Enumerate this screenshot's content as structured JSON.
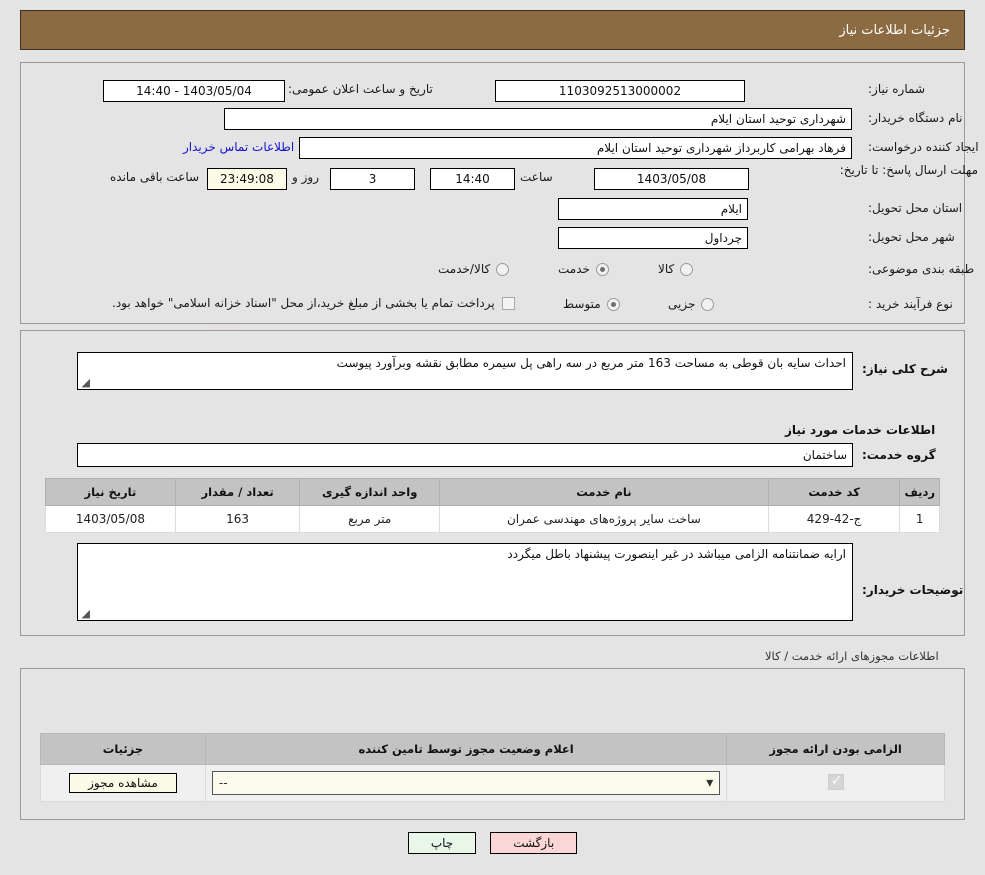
{
  "header": {
    "title": "جزئیات اطلاعات نیاز"
  },
  "form": {
    "need_number_label": "شماره نیاز:",
    "need_number": "1103092513000002",
    "announce_label": "تاریخ و ساعت اعلان عمومی:",
    "announce_value": "1403/05/04 - 14:40",
    "buyer_org_label": "نام دستگاه خریدار:",
    "buyer_org": "شهرداری توحید استان ایلام",
    "creator_label": "ایجاد کننده درخواست:",
    "creator": "فرهاد بهرامی کاربرداز شهرداری توحید استان ایلام",
    "contact_link": "اطلاعات تماس خریدار",
    "deadline_label": "مهلت ارسال پاسخ: تا تاریخ:",
    "deadline_date": "1403/05/08",
    "hour_label": "ساعت",
    "deadline_time": "14:40",
    "days_value": "3",
    "days_unit": "روز و",
    "countdown": "23:49:08",
    "countdown_suffix": "ساعت باقی مانده",
    "province_label": "استان محل تحویل:",
    "province": "ایلام",
    "city_label": "شهر محل تحویل:",
    "city": "چرداول",
    "category_label": "طبقه بندی موضوعی:",
    "category_options": [
      {
        "label": "کالا",
        "selected": false
      },
      {
        "label": "خدمت",
        "selected": true
      },
      {
        "label": "کالا/خدمت",
        "selected": false
      }
    ],
    "process_label": "نوع فرآیند خرید :",
    "process_options": [
      {
        "label": "جزیی",
        "selected": false
      },
      {
        "label": "متوسط",
        "selected": true
      }
    ],
    "treasury_checkbox_label": "پرداخت تمام یا بخشی از مبلغ خرید،از محل \"اسناد خزانه اسلامی\" خواهد بود.",
    "treasury_checked": false
  },
  "description": {
    "label": "شرح کلی نیاز:",
    "text": "احداث سایه بان قوطی به مساحت 163 متر مربع در سه راهی پل سیمره مطابق نقشه وبرآورد پیوست"
  },
  "services": {
    "section_title": "اطلاعات خدمات مورد نیاز",
    "group_label": "گروه خدمت:",
    "group_value": "ساختمان",
    "columns": [
      "ردیف",
      "کد خدمت",
      "نام خدمت",
      "واحد اندازه گیری",
      "تعداد / مقدار",
      "تاریخ نیاز"
    ],
    "rows": [
      {
        "index": "1",
        "code": "ج-42-429",
        "name": "ساخت سایر پروژه‌های مهندسی عمران",
        "unit": "متر مربع",
        "quantity": "163",
        "need_date": "1403/05/08"
      }
    ]
  },
  "buyer_notes": {
    "label": "توضیحات خریدار:",
    "text": "ارایه ضمانتنامه الزامی میباشد در غیر اینصورت پیشنهاد باطل میگردد"
  },
  "licenses": {
    "section_note": "اطلاعات مجوزهای ارائه خدمت / کالا",
    "columns": [
      "الزامی بودن ارائه مجوز",
      "اعلام وضعیت مجوز توسط تامین کننده",
      "جزئیات"
    ],
    "rows": [
      {
        "required_checked": true,
        "status_value": "--",
        "details_button": "مشاهده مجوز"
      }
    ]
  },
  "footer": {
    "print_label": "چاپ",
    "back_label": "بازگشت"
  },
  "watermark": {
    "text_main": "AriaTende",
    "text_tld": "r.net"
  },
  "colors": {
    "header_bg": "#8c6b43",
    "page_bg": "#e4e4e4",
    "link": "#1414d2",
    "table_header": "#c3c3c3",
    "print_btn": "#e9f7e9",
    "back_btn": "#fbd6d6",
    "cream": "#fbfbe8"
  }
}
